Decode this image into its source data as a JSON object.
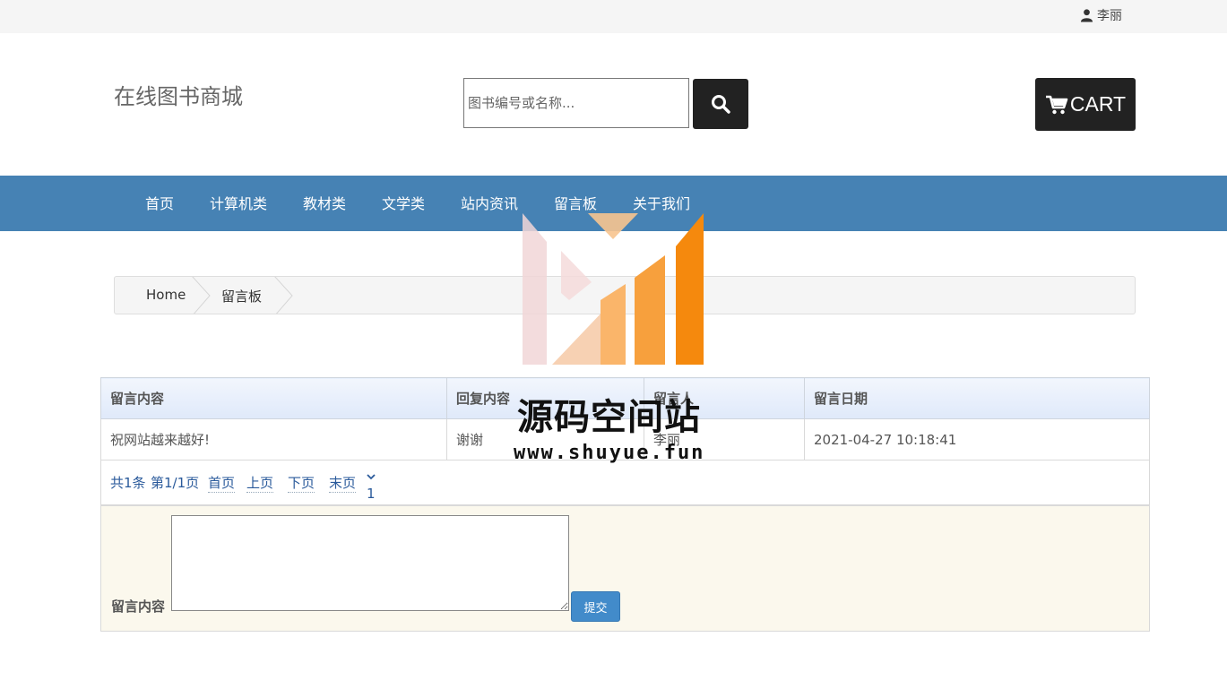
{
  "topbar": {
    "user_name": "李丽"
  },
  "header": {
    "site_title": "在线图书商城",
    "search_placeholder": "图书编号或名称...",
    "cart_label": "CART"
  },
  "nav": {
    "items": [
      "首页",
      "计算机类",
      "教材类",
      "文学类",
      "站内资讯",
      "留言板",
      "关于我们"
    ]
  },
  "breadcrumb": {
    "home": "Home",
    "current": "留言板"
  },
  "table": {
    "headers": [
      "留言内容",
      "回复内容",
      "留言人",
      "留言日期"
    ],
    "rows": [
      [
        "祝网站越来越好!",
        "谢谢",
        "李丽",
        "2021-04-27 10:18:41"
      ]
    ]
  },
  "pager": {
    "total": "共1条",
    "page_info": "第1/1页",
    "first": "首页",
    "prev": "上页",
    "next": "下页",
    "last": "末页",
    "page_select": "1"
  },
  "form": {
    "label": "留言内容",
    "submit": "提交",
    "message_value": ""
  },
  "watermark": {
    "title": "源码空间站",
    "url": "www.shuyue.fun"
  },
  "colors": {
    "nav_bg": "#4682b4",
    "dark_button": "#222222",
    "submit_bg": "#428bca",
    "form_bg": "#fbf8ed"
  }
}
